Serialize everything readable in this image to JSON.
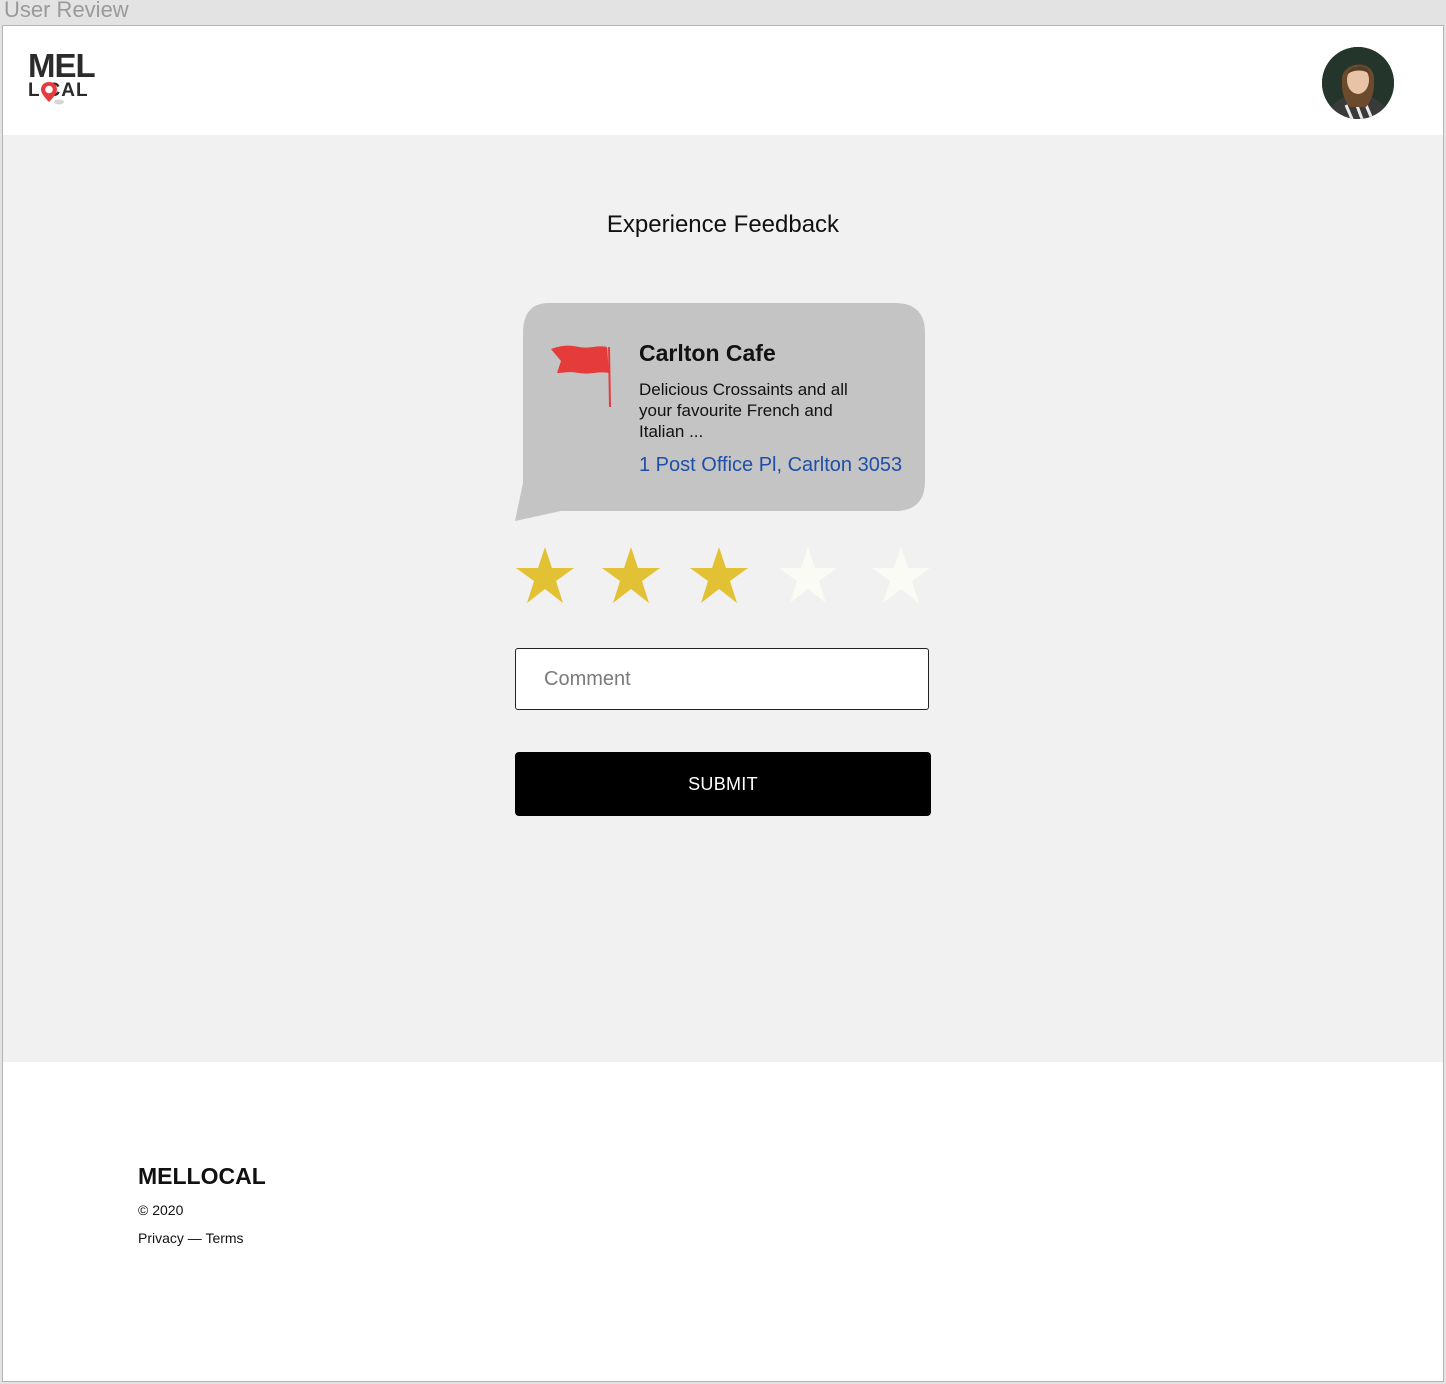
{
  "window": {
    "title": "User Review"
  },
  "header": {
    "logo": {
      "line1": "MEL",
      "line2": "L CAL",
      "icon": "map-pin-icon"
    },
    "avatar": {
      "icon": "user-avatar"
    }
  },
  "main": {
    "title": "Experience Feedback",
    "place": {
      "icon": "flag-icon",
      "name": "Carlton Cafe",
      "description": "Delicious Crossaints and all\n your favourite French and\nItalian ...",
      "address": "1 Post Office Pl, Carlton 3053"
    },
    "rating": {
      "value": 3,
      "max": 5,
      "filled_color": "#e3c134",
      "empty_color": "#fbfbf6"
    },
    "comment": {
      "placeholder": "Comment",
      "value": ""
    },
    "submit_label": "SUBMIT"
  },
  "footer": {
    "brand": "MELLOCAL",
    "copyright": "© 2020",
    "privacy_label": "Privacy",
    "separator": " — ",
    "terms_label": "Terms"
  },
  "colors": {
    "accent_red": "#e63b3b",
    "link_blue": "#1f4fa8",
    "card_bg": "#c4c4c4",
    "page_bg": "#f1f1f1"
  }
}
